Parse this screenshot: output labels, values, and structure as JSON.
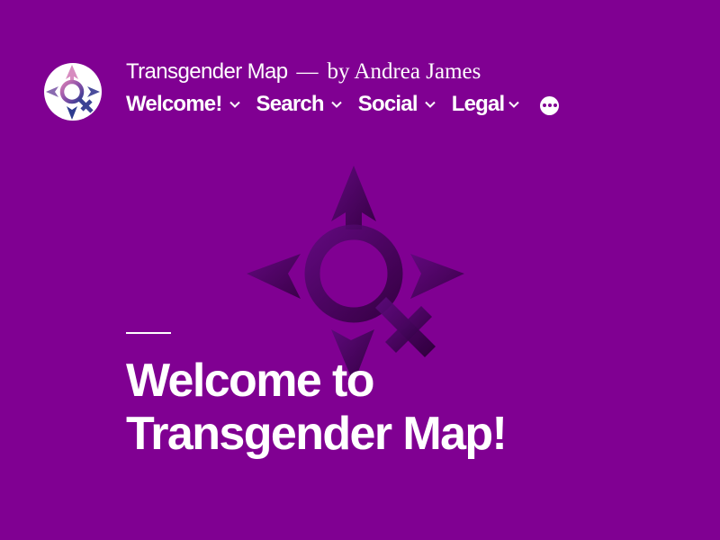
{
  "colors": {
    "background": "#800092",
    "text": "#ffffff",
    "emblem_dark": "#3a0046"
  },
  "site": {
    "title": "Transgender Map",
    "separator": "—",
    "description": "by Andrea James",
    "logo_icon": "transgender-compass-logo-icon"
  },
  "nav": {
    "items": [
      {
        "label": "Welcome!",
        "icon": "chevron-down-icon"
      },
      {
        "label": "Search",
        "icon": "chevron-down-icon"
      },
      {
        "label": "Social",
        "icon": "chevron-down-icon"
      },
      {
        "label": "Legal",
        "icon": "chevron-down-icon"
      }
    ],
    "more_icon": "more-horizontal-icon"
  },
  "hero": {
    "line1": "Welcome to",
    "line2": "Transgender Map!",
    "emblem_icon": "transgender-compass-emblem-icon"
  }
}
